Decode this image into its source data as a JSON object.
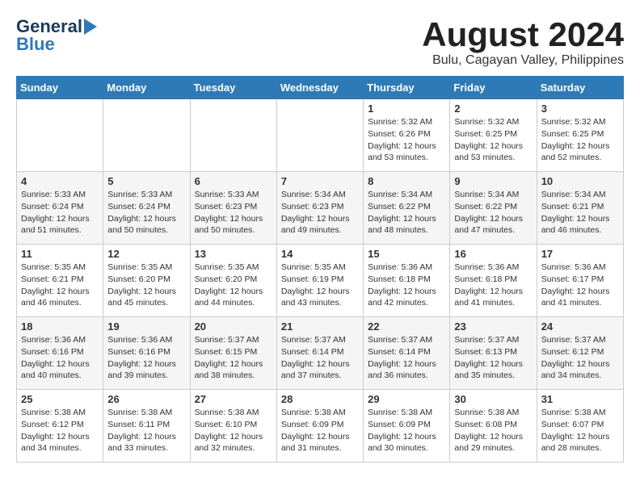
{
  "header": {
    "logo_line1": "General",
    "logo_line2": "Blue",
    "title": "August 2024",
    "subtitle": "Bulu, Cagayan Valley, Philippines"
  },
  "calendar": {
    "days_of_week": [
      "Sunday",
      "Monday",
      "Tuesday",
      "Wednesday",
      "Thursday",
      "Friday",
      "Saturday"
    ],
    "weeks": [
      [
        {
          "day": "",
          "content": ""
        },
        {
          "day": "",
          "content": ""
        },
        {
          "day": "",
          "content": ""
        },
        {
          "day": "",
          "content": ""
        },
        {
          "day": "1",
          "content": "Sunrise: 5:32 AM\nSunset: 6:26 PM\nDaylight: 12 hours\nand 53 minutes."
        },
        {
          "day": "2",
          "content": "Sunrise: 5:32 AM\nSunset: 6:25 PM\nDaylight: 12 hours\nand 53 minutes."
        },
        {
          "day": "3",
          "content": "Sunrise: 5:32 AM\nSunset: 6:25 PM\nDaylight: 12 hours\nand 52 minutes."
        }
      ],
      [
        {
          "day": "4",
          "content": "Sunrise: 5:33 AM\nSunset: 6:24 PM\nDaylight: 12 hours\nand 51 minutes."
        },
        {
          "day": "5",
          "content": "Sunrise: 5:33 AM\nSunset: 6:24 PM\nDaylight: 12 hours\nand 50 minutes."
        },
        {
          "day": "6",
          "content": "Sunrise: 5:33 AM\nSunset: 6:23 PM\nDaylight: 12 hours\nand 50 minutes."
        },
        {
          "day": "7",
          "content": "Sunrise: 5:34 AM\nSunset: 6:23 PM\nDaylight: 12 hours\nand 49 minutes."
        },
        {
          "day": "8",
          "content": "Sunrise: 5:34 AM\nSunset: 6:22 PM\nDaylight: 12 hours\nand 48 minutes."
        },
        {
          "day": "9",
          "content": "Sunrise: 5:34 AM\nSunset: 6:22 PM\nDaylight: 12 hours\nand 47 minutes."
        },
        {
          "day": "10",
          "content": "Sunrise: 5:34 AM\nSunset: 6:21 PM\nDaylight: 12 hours\nand 46 minutes."
        }
      ],
      [
        {
          "day": "11",
          "content": "Sunrise: 5:35 AM\nSunset: 6:21 PM\nDaylight: 12 hours\nand 46 minutes."
        },
        {
          "day": "12",
          "content": "Sunrise: 5:35 AM\nSunset: 6:20 PM\nDaylight: 12 hours\nand 45 minutes."
        },
        {
          "day": "13",
          "content": "Sunrise: 5:35 AM\nSunset: 6:20 PM\nDaylight: 12 hours\nand 44 minutes."
        },
        {
          "day": "14",
          "content": "Sunrise: 5:35 AM\nSunset: 6:19 PM\nDaylight: 12 hours\nand 43 minutes."
        },
        {
          "day": "15",
          "content": "Sunrise: 5:36 AM\nSunset: 6:18 PM\nDaylight: 12 hours\nand 42 minutes."
        },
        {
          "day": "16",
          "content": "Sunrise: 5:36 AM\nSunset: 6:18 PM\nDaylight: 12 hours\nand 41 minutes."
        },
        {
          "day": "17",
          "content": "Sunrise: 5:36 AM\nSunset: 6:17 PM\nDaylight: 12 hours\nand 41 minutes."
        }
      ],
      [
        {
          "day": "18",
          "content": "Sunrise: 5:36 AM\nSunset: 6:16 PM\nDaylight: 12 hours\nand 40 minutes."
        },
        {
          "day": "19",
          "content": "Sunrise: 5:36 AM\nSunset: 6:16 PM\nDaylight: 12 hours\nand 39 minutes."
        },
        {
          "day": "20",
          "content": "Sunrise: 5:37 AM\nSunset: 6:15 PM\nDaylight: 12 hours\nand 38 minutes."
        },
        {
          "day": "21",
          "content": "Sunrise: 5:37 AM\nSunset: 6:14 PM\nDaylight: 12 hours\nand 37 minutes."
        },
        {
          "day": "22",
          "content": "Sunrise: 5:37 AM\nSunset: 6:14 PM\nDaylight: 12 hours\nand 36 minutes."
        },
        {
          "day": "23",
          "content": "Sunrise: 5:37 AM\nSunset: 6:13 PM\nDaylight: 12 hours\nand 35 minutes."
        },
        {
          "day": "24",
          "content": "Sunrise: 5:37 AM\nSunset: 6:12 PM\nDaylight: 12 hours\nand 34 minutes."
        }
      ],
      [
        {
          "day": "25",
          "content": "Sunrise: 5:38 AM\nSunset: 6:12 PM\nDaylight: 12 hours\nand 34 minutes."
        },
        {
          "day": "26",
          "content": "Sunrise: 5:38 AM\nSunset: 6:11 PM\nDaylight: 12 hours\nand 33 minutes."
        },
        {
          "day": "27",
          "content": "Sunrise: 5:38 AM\nSunset: 6:10 PM\nDaylight: 12 hours\nand 32 minutes."
        },
        {
          "day": "28",
          "content": "Sunrise: 5:38 AM\nSunset: 6:09 PM\nDaylight: 12 hours\nand 31 minutes."
        },
        {
          "day": "29",
          "content": "Sunrise: 5:38 AM\nSunset: 6:09 PM\nDaylight: 12 hours\nand 30 minutes."
        },
        {
          "day": "30",
          "content": "Sunrise: 5:38 AM\nSunset: 6:08 PM\nDaylight: 12 hours\nand 29 minutes."
        },
        {
          "day": "31",
          "content": "Sunrise: 5:38 AM\nSunset: 6:07 PM\nDaylight: 12 hours\nand 28 minutes."
        }
      ]
    ]
  }
}
